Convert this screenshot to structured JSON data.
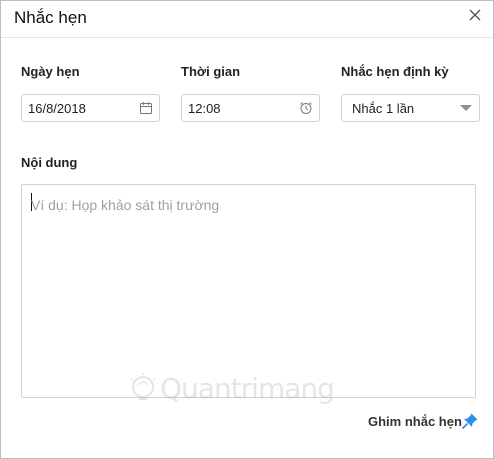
{
  "dialog": {
    "title": "Nhắc hẹn"
  },
  "date": {
    "label": "Ngày hẹn",
    "value": "16/8/2018",
    "icon": "calendar-icon"
  },
  "time": {
    "label": "Thời gian",
    "value": "12:08",
    "icon": "alarm-clock-icon"
  },
  "repeat": {
    "label": "Nhắc hẹn định kỳ",
    "selected": "Nhắc 1 lần",
    "icon": "dropdown-arrow-icon"
  },
  "content": {
    "label": "Nội dung",
    "placeholder": "Ví dụ: Họp khảo sát thị trường"
  },
  "pin": {
    "label": "Ghim nhắc hẹn",
    "icon": "pin-icon",
    "color": "#2b8fe6"
  },
  "watermark": {
    "text": "Quantrimang"
  }
}
